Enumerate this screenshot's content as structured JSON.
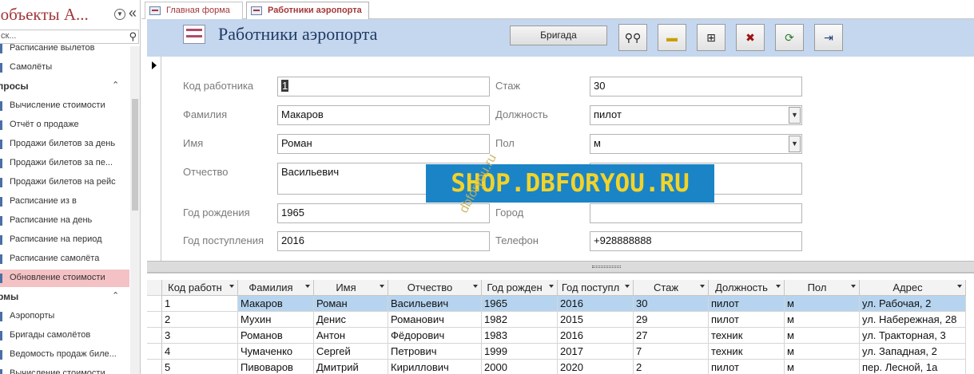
{
  "nav": {
    "title": "е объекты A...",
    "search_placeholder": "ск...",
    "items": [
      {
        "kind": "item",
        "label": "Расписание вылетов",
        "top": 0
      },
      {
        "kind": "item",
        "label": "Самолёты"
      },
      {
        "kind": "group",
        "label": "просы"
      },
      {
        "kind": "item",
        "label": "Вычисление стоимости"
      },
      {
        "kind": "item",
        "label": "Отчёт о продаже"
      },
      {
        "kind": "item",
        "label": "Продажи билетов за день"
      },
      {
        "kind": "item",
        "label": "Продажи билетов за пе..."
      },
      {
        "kind": "item",
        "label": "Продажи билетов на рейс"
      },
      {
        "kind": "item",
        "label": "Расписание из в"
      },
      {
        "kind": "item",
        "label": "Расписание на день"
      },
      {
        "kind": "item",
        "label": "Расписание на период"
      },
      {
        "kind": "item",
        "label": "Расписание самолёта"
      },
      {
        "kind": "item",
        "label": "Обновление стоимости",
        "selected": true
      },
      {
        "kind": "group",
        "label": "рмы"
      },
      {
        "kind": "item",
        "label": "Аэропорты"
      },
      {
        "kind": "item",
        "label": "Бригады самолётов"
      },
      {
        "kind": "item",
        "label": "Ведомость продаж биле..."
      },
      {
        "kind": "item",
        "label": "Вычисление стоимости"
      }
    ]
  },
  "tabs": [
    {
      "label": "Главная форма",
      "active": false
    },
    {
      "label": "Работники аэропорта",
      "active": true
    }
  ],
  "form": {
    "title": "Работники аэропорта",
    "brigade_button": "Бригада",
    "tools": [
      {
        "icon": "binoculars-icon",
        "glyph": "🔭"
      },
      {
        "icon": "new-record-icon",
        "glyph": "⊞"
      },
      {
        "icon": "add-record-icon",
        "glyph": "⊕"
      },
      {
        "icon": "delete-record-icon",
        "glyph": "✖"
      },
      {
        "icon": "refresh-icon",
        "glyph": "⟳"
      },
      {
        "icon": "exit-icon",
        "glyph": "⇥"
      }
    ],
    "fields_left": [
      {
        "label": "Код работника",
        "value": "1"
      },
      {
        "label": "Фамилия",
        "value": "Макаров"
      },
      {
        "label": "Имя",
        "value": "Роман"
      },
      {
        "label": "Отчество",
        "value": "Васильевич"
      },
      {
        "label": "Год рождения",
        "value": "1965"
      },
      {
        "label": "Год поступления",
        "value": "2016"
      }
    ],
    "fields_right": [
      {
        "label": "Стаж",
        "value": "30"
      },
      {
        "label": "Должность",
        "value": "пилот"
      },
      {
        "label": "Пол",
        "value": "м"
      },
      {
        "label": "",
        "value": ""
      },
      {
        "label": "Город",
        "value": ""
      },
      {
        "label": "Телефон",
        "value": "+928888888"
      }
    ]
  },
  "watermark": {
    "main": "SHOP.DBFORYOU.RU",
    "diag": "dbforyou.ru"
  },
  "grid": {
    "columns": [
      "Код работн",
      "Фамилия",
      "Имя",
      "Отчество",
      "Год рожден",
      "Год поступл",
      "Стаж",
      "Должность",
      "Пол",
      "Адрес"
    ],
    "rows": [
      [
        "1",
        "Макаров",
        "Роман",
        "Васильевич",
        "1965",
        "2016",
        "30",
        "пилот",
        "м",
        "ул. Рабочая, 2"
      ],
      [
        "2",
        "Мухин",
        "Денис",
        "Романович",
        "1982",
        "2015",
        "29",
        "пилот",
        "м",
        "ул. Набережная, 28"
      ],
      [
        "3",
        "Романов",
        "Антон",
        "Фёдорович",
        "1983",
        "2016",
        "27",
        "техник",
        "м",
        "ул. Тракторная, 3"
      ],
      [
        "4",
        "Чумаченко",
        "Сергей",
        "Петрович",
        "1999",
        "2017",
        "7",
        "техник",
        "м",
        "ул. Западная, 2"
      ],
      [
        "5",
        "Пивоваров",
        "Дмитрий",
        "Кириллович",
        "2000",
        "2020",
        "2",
        "пилот",
        "м",
        "пер. Лесной, 1а"
      ]
    ]
  },
  "colors": {
    "accent": "#a4373a",
    "header_band": "#c5d7ee",
    "selection": "#b6d4ef",
    "watermark_bg": "#1b84c6",
    "watermark_fg": "#f2d32a"
  }
}
